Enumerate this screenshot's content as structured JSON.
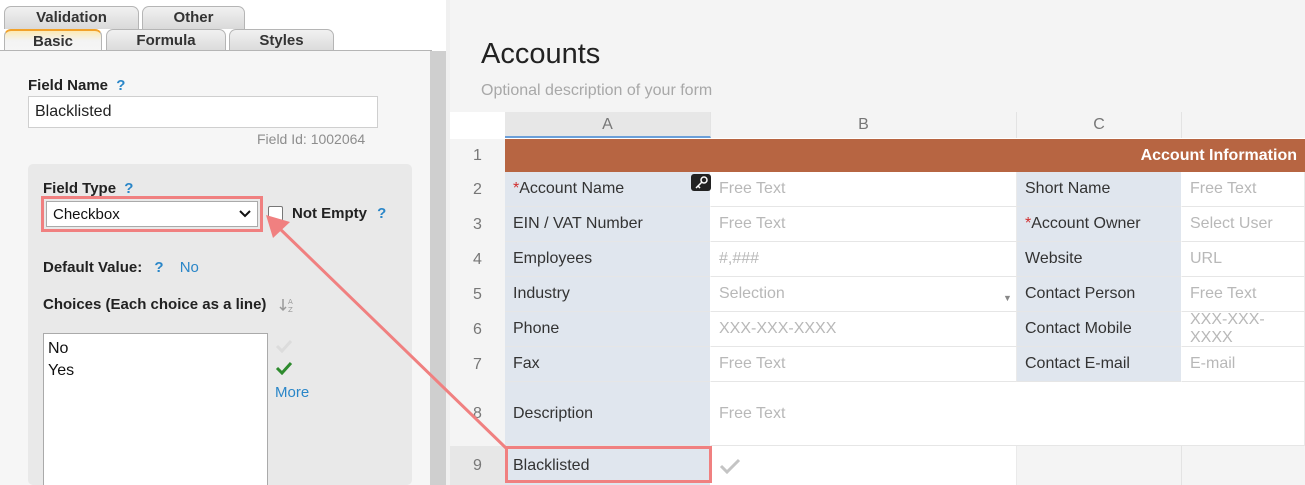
{
  "tabs": {
    "row1": [
      "Validation",
      "Other"
    ],
    "row2": [
      "Basic",
      "Formula",
      "Styles"
    ],
    "active": "Basic"
  },
  "settings": {
    "field_name_label": "Field Name",
    "help_glyph": "?",
    "field_name_value": "Blacklisted",
    "field_id_text": "Field Id: 1002064",
    "field_type_label": "Field Type",
    "field_type_value": "Checkbox",
    "not_empty_label": "Not Empty",
    "default_value_label": "Default Value:",
    "default_value": "No",
    "choices_label": "Choices (Each choice as a line)",
    "choices": [
      "No",
      "Yes"
    ],
    "more_link": "More"
  },
  "form": {
    "title": "Accounts",
    "description": "Optional description of your form",
    "columns": [
      "A",
      "B",
      "C"
    ],
    "row_numbers": [
      "1",
      "2",
      "3",
      "4",
      "5",
      "6",
      "7",
      "8",
      "9"
    ],
    "section_title": "Account Information",
    "rows": [
      {
        "label": "Account Name",
        "required": true,
        "placeholder": "Free Text",
        "label2": "Short Name",
        "required2": false,
        "placeholder2": "Free Text"
      },
      {
        "label": "EIN / VAT Number",
        "required": false,
        "placeholder": "Free Text",
        "label2": "Account Owner",
        "required2": true,
        "placeholder2": "Select User"
      },
      {
        "label": "Employees",
        "required": false,
        "placeholder": "#,###",
        "label2": "Website",
        "required2": false,
        "placeholder2": "URL"
      },
      {
        "label": "Industry",
        "required": false,
        "placeholder": "Selection",
        "label2": "Contact Person",
        "required2": false,
        "placeholder2": "Free Text"
      },
      {
        "label": "Phone",
        "required": false,
        "placeholder": "XXX-XXX-XXXX",
        "label2": "Contact Mobile",
        "required2": false,
        "placeholder2": "XXX-XXX-XXXX"
      },
      {
        "label": "Fax",
        "required": false,
        "placeholder": "Free Text",
        "label2": "Contact E-mail",
        "required2": false,
        "placeholder2": "E-mail"
      }
    ],
    "description_row": {
      "label": "Description",
      "placeholder": "Free Text"
    },
    "blacklisted_row": {
      "label": "Blacklisted"
    }
  },
  "colors": {
    "accent": "#b76542",
    "highlight": "#f08080",
    "help": "#2a86c8",
    "label_bg": "#e0e6ee"
  }
}
